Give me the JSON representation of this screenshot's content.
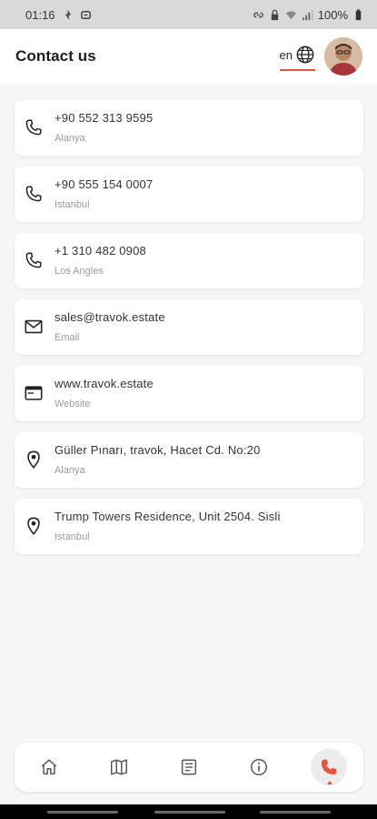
{
  "status_bar": {
    "time": "01:16",
    "battery": "100%"
  },
  "header": {
    "title": "Contact us",
    "language": "en"
  },
  "contacts": [
    {
      "icon": "phone-icon",
      "primary": "+90 552 313 9595",
      "secondary": "Alanya"
    },
    {
      "icon": "phone-icon",
      "primary": "+90 555 154 0007",
      "secondary": "Istanbul"
    },
    {
      "icon": "phone-icon",
      "primary": "+1 310 482 0908",
      "secondary": "Los Angles"
    },
    {
      "icon": "mail-icon",
      "primary": "sales@travok.estate",
      "secondary": "Email"
    },
    {
      "icon": "website-icon",
      "primary": "www.travok.estate",
      "secondary": "Website"
    },
    {
      "icon": "location-pin-icon",
      "primary": "Güller Pınarı, travok, Hacet Cd. No:20",
      "secondary": "Alanya"
    },
    {
      "icon": "location-pin-icon",
      "primary": "Trump Towers Residence, Unit 2504. Sisli",
      "secondary": "Istanbul"
    }
  ],
  "bottom_nav": {
    "items": [
      "home-icon",
      "map-icon",
      "document-icon",
      "info-icon",
      "phone-icon"
    ],
    "active": "phone-icon"
  },
  "colors": {
    "accent": "#e8533f",
    "card_background": "#ffffff",
    "page_background": "#f6f6f6"
  }
}
